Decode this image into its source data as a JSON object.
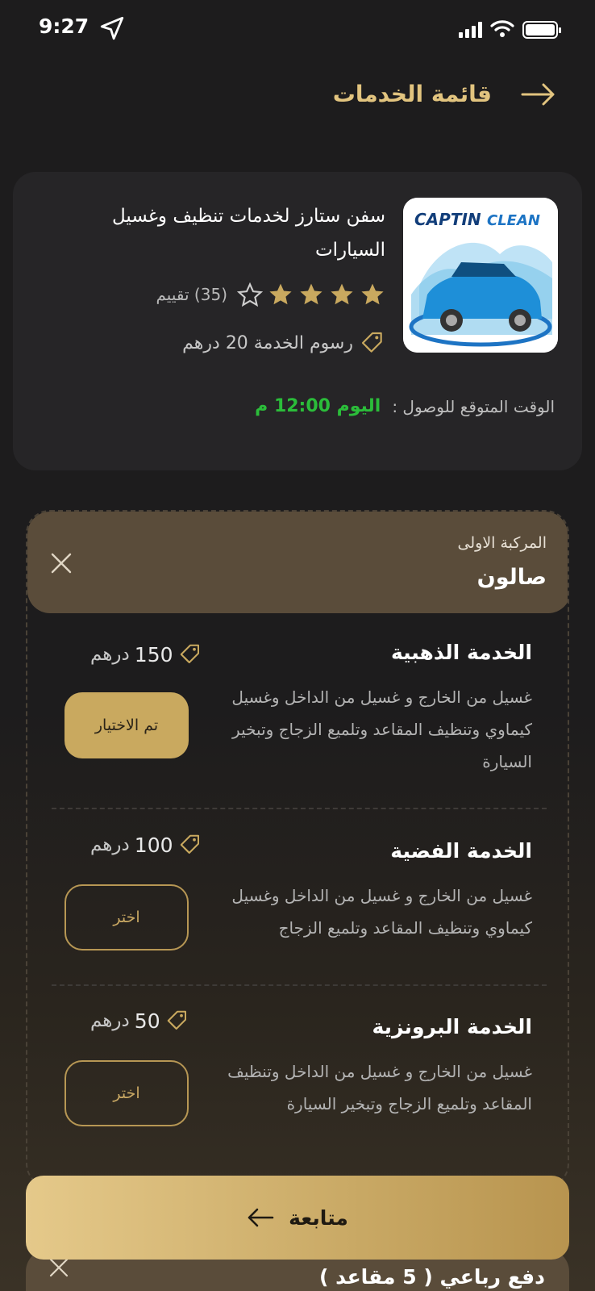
{
  "status_bar": {
    "time": "9:27"
  },
  "header": {
    "title": "قائمة الخدمات"
  },
  "store": {
    "name": "سفن ستارز لخدمات تنظيف وغسيل السيارات",
    "logo_text_a": "CAPTIN",
    "logo_text_b": "CLEAN",
    "rating_filled": 4,
    "rating_total": 5,
    "rating_count_text": "(35) تقييم",
    "fee_text": "رسوم الخدمة 20 درهم",
    "eta_label": "الوقت المتوقع للوصول :",
    "eta_value": "اليوم 12:00 م"
  },
  "vehicle": {
    "subtitle": "المركبة الاولى",
    "type": "صالون"
  },
  "services": [
    {
      "title": "الخدمة الذهبية",
      "description": "غسيل من الخارج و غسيل من الداخل وغسيل كيماوي وتنظيف المقاعد وتلميع الزجاج وتبخير السيارة",
      "price": "150",
      "currency": "درهم",
      "button_label": "تم الاختيار",
      "selected": true
    },
    {
      "title": "الخدمة الفضية",
      "description": "غسيل من الخارج و غسيل من الداخل وغسيل كيماوي وتنظيف المقاعد وتلميع الزجاج",
      "price": "100",
      "currency": "درهم",
      "button_label": "اختر",
      "selected": false
    },
    {
      "title": "الخدمة البرونزية",
      "description": "غسيل من الخارج و غسيل من الداخل وتنظيف المقاعد وتلميع الزجاج وتبخير السيارة",
      "price": "50",
      "currency": "درهم",
      "button_label": "اختر",
      "selected": false
    }
  ],
  "continue_label": "متابعة",
  "next_vehicle": {
    "label": "دفع رباعي ( 5 مقاعد )"
  },
  "colors": {
    "accent": "#e2c47f",
    "selected_button": "#c9a95f",
    "eta_green": "#2bbd3a",
    "star_gold": "#c9a95f"
  }
}
